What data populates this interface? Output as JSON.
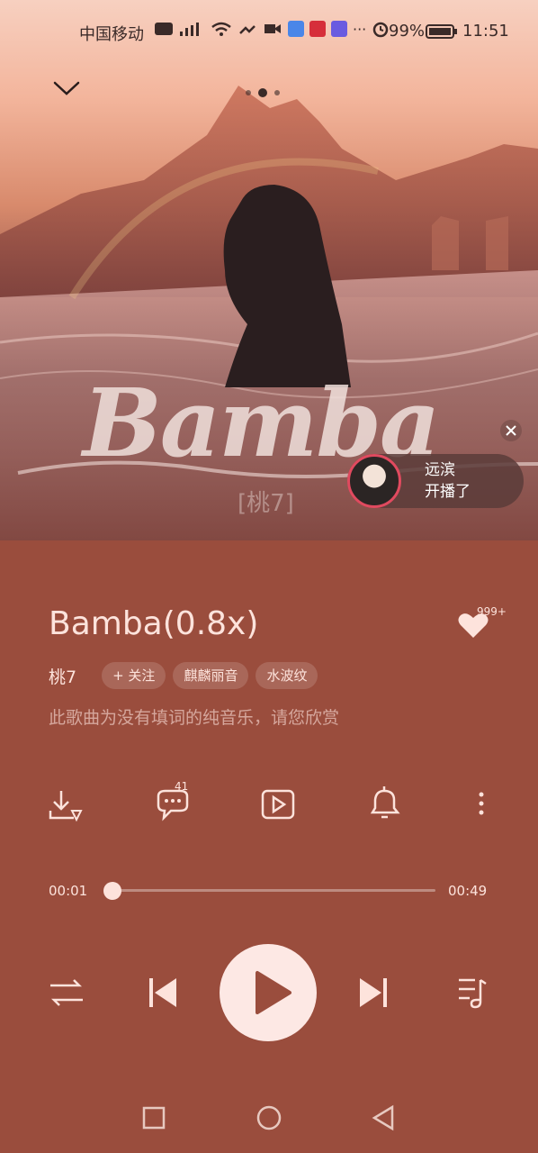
{
  "status": {
    "carrier": "中国移动",
    "battery": "99%",
    "time": "11:51"
  },
  "cover": {
    "title_art": "Bamba",
    "artist_art": "[桃7]"
  },
  "live": {
    "line1": "远滨",
    "line2": "开播了"
  },
  "song": {
    "title": "Bamba(0.8x)",
    "artist": "桃7",
    "follow": "+ 关注",
    "tags": [
      "麒麟丽音",
      "水波纹"
    ],
    "note": "此歌曲为没有填词的纯音乐，请您欣赏",
    "likes": "999+",
    "comments": "41"
  },
  "player": {
    "current": "00:01",
    "total": "00:49",
    "progress": 0.02
  },
  "icons": {
    "collapse": "chevron-down-icon",
    "download": "download-icon",
    "comment": "comment-icon",
    "video": "video-icon",
    "ringtone": "bell-icon",
    "more": "more-icon",
    "mode": "repeat-icon",
    "prev": "previous-icon",
    "play": "play-icon",
    "next": "next-icon",
    "playlist": "playlist-icon"
  }
}
